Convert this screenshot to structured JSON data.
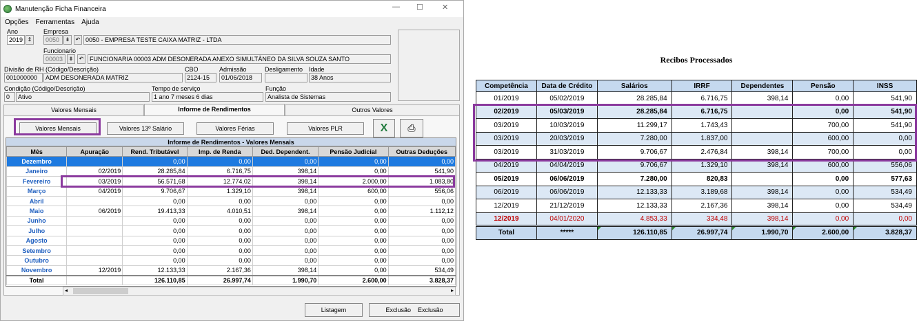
{
  "window": {
    "title": "Manutenção Ficha Financeira",
    "minimize": "—",
    "maximize": "☐",
    "close": "✕"
  },
  "menu": [
    "Opções",
    "Ferramentas",
    "Ajuda"
  ],
  "form": {
    "ano_label": "Ano",
    "ano": "2019",
    "empresa_label": "Empresa",
    "empresa_code": "0050",
    "empresa_name": "0050 - EMPRESA TESTE CAIXA MATRIZ - LTDA",
    "funcionario_label": "Funcionario",
    "funcionario_code": "00003",
    "funcionario_name": "FUNCIONARIA 00003 ADM DESONERADA ANEXO SIMULTÂNEO DA SILVA SOUZA SANTO",
    "divisao_label": "Divisão de RH (Código/Descrição)",
    "divisao_code": "001000000",
    "divisao_desc": "ADM DESONERADA MATRIZ",
    "cbo_label": "CBO",
    "cbo": "2124-15",
    "admissao_label": "Admissão",
    "admissao": "01/06/2018",
    "desligamento_label": "Desligamento",
    "desligamento": "",
    "idade_label": "Idade",
    "idade": "38 Anos",
    "condicao_label": "Condição (Código/Descrição)",
    "condicao_code": "0",
    "condicao_desc": "Ativo",
    "tempo_label": "Tempo de serviço",
    "tempo": "1 ano 7 meses 6 dias",
    "funcao_label": "Função",
    "funcao": "Analista de Sistemas"
  },
  "tabs": [
    "Valores Mensais",
    "Informe de Rendimentos",
    "Outros Valores"
  ],
  "panel_buttons": [
    "Valores Mensais",
    "Valores 13º Salário",
    "Valores Férias",
    "Valores PLR"
  ],
  "grid": {
    "title": "Informe de Rendimentos - Valores Mensais",
    "columns": [
      "Mês",
      "Apuração",
      "Rend. Tributável",
      "Imp. de Renda",
      "Ded. Dependent.",
      "Pensão Judicial",
      "Outras Deduções"
    ],
    "rows": [
      [
        "Dezembro",
        "",
        "0,00",
        "0,00",
        "0,00",
        "0,00",
        "0,00"
      ],
      [
        "Janeiro",
        "02/2019",
        "28.285,84",
        "6.716,75",
        "398,14",
        "0,00",
        "541,90"
      ],
      [
        "Fevereiro",
        "03/2019",
        "56.571,68",
        "12.774,02",
        "398,14",
        "2.000,00",
        "1.083,80"
      ],
      [
        "Março",
        "04/2019",
        "9.706,67",
        "1.329,10",
        "398,14",
        "600,00",
        "556,06"
      ],
      [
        "Abril",
        "",
        "0,00",
        "0,00",
        "0,00",
        "0,00",
        "0,00"
      ],
      [
        "Maio",
        "06/2019",
        "19.413,33",
        "4.010,51",
        "398,14",
        "0,00",
        "1.112,12"
      ],
      [
        "Junho",
        "",
        "0,00",
        "0,00",
        "0,00",
        "0,00",
        "0,00"
      ],
      [
        "Julho",
        "",
        "0,00",
        "0,00",
        "0,00",
        "0,00",
        "0,00"
      ],
      [
        "Agosto",
        "",
        "0,00",
        "0,00",
        "0,00",
        "0,00",
        "0,00"
      ],
      [
        "Setembro",
        "",
        "0,00",
        "0,00",
        "0,00",
        "0,00",
        "0,00"
      ],
      [
        "Outubro",
        "",
        "0,00",
        "0,00",
        "0,00",
        "0,00",
        "0,00"
      ],
      [
        "Novembro",
        "12/2019",
        "12.133,33",
        "2.167,36",
        "398,14",
        "0,00",
        "534,49"
      ]
    ],
    "total": [
      "Total",
      "",
      "126.110,85",
      "26.997,74",
      "1.990,70",
      "2.600,00",
      "3.828,37"
    ]
  },
  "bottom_buttons": [
    "Listagem",
    "Exclusão",
    "Exclusão"
  ],
  "recibos": {
    "title": "Recibos Processados",
    "columns": [
      "Competência",
      "Data de Crédito",
      "Salários",
      "IRRF",
      "Dependentes",
      "Pensão",
      "INSS"
    ],
    "rows": [
      [
        "01/2019",
        "05/02/2019",
        "28.285,84",
        "6.716,75",
        "398,14",
        "0,00",
        "541,90"
      ],
      [
        "02/2019",
        "05/03/2019",
        "28.285,84",
        "6.716,75",
        "",
        "0,00",
        "541,90"
      ],
      [
        "03/2019",
        "10/03/2019",
        "11.299,17",
        "1.743,43",
        "",
        "700,00",
        "541,90"
      ],
      [
        "03/2019",
        "20/03/2019",
        "7.280,00",
        "1.837,00",
        "",
        "600,00",
        "0,00"
      ],
      [
        "03/2019",
        "31/03/2019",
        "9.706,67",
        "2.476,84",
        "398,14",
        "700,00",
        "0,00"
      ],
      [
        "04/2019",
        "04/04/2019",
        "9.706,67",
        "1.329,10",
        "398,14",
        "600,00",
        "556,06"
      ],
      [
        "05/2019",
        "06/06/2019",
        "7.280,00",
        "820,83",
        "",
        "0,00",
        "577,63"
      ],
      [
        "06/2019",
        "06/06/2019",
        "12.133,33",
        "3.189,68",
        "398,14",
        "0,00",
        "534,49"
      ],
      [
        "12/2019",
        "21/12/2019",
        "12.133,33",
        "2.167,36",
        "398,14",
        "0,00",
        "534,49"
      ],
      [
        "12/2019",
        "04/01/2020",
        "4.853,33",
        "334,48",
        "398,14",
        "0,00",
        "0,00"
      ]
    ],
    "total": [
      "Total",
      "*****",
      "126.110,85",
      "26.997,74",
      "1.990,70",
      "2.600,00",
      "3.828,37"
    ]
  },
  "colors": {
    "highlight": "#8b3a9e",
    "selected_row": "#1e7ae0",
    "month_text": "#1f5fbf",
    "header_blue": "#c5d9ef",
    "alt_row": "#dce8f5",
    "red_row": "#c00000"
  }
}
